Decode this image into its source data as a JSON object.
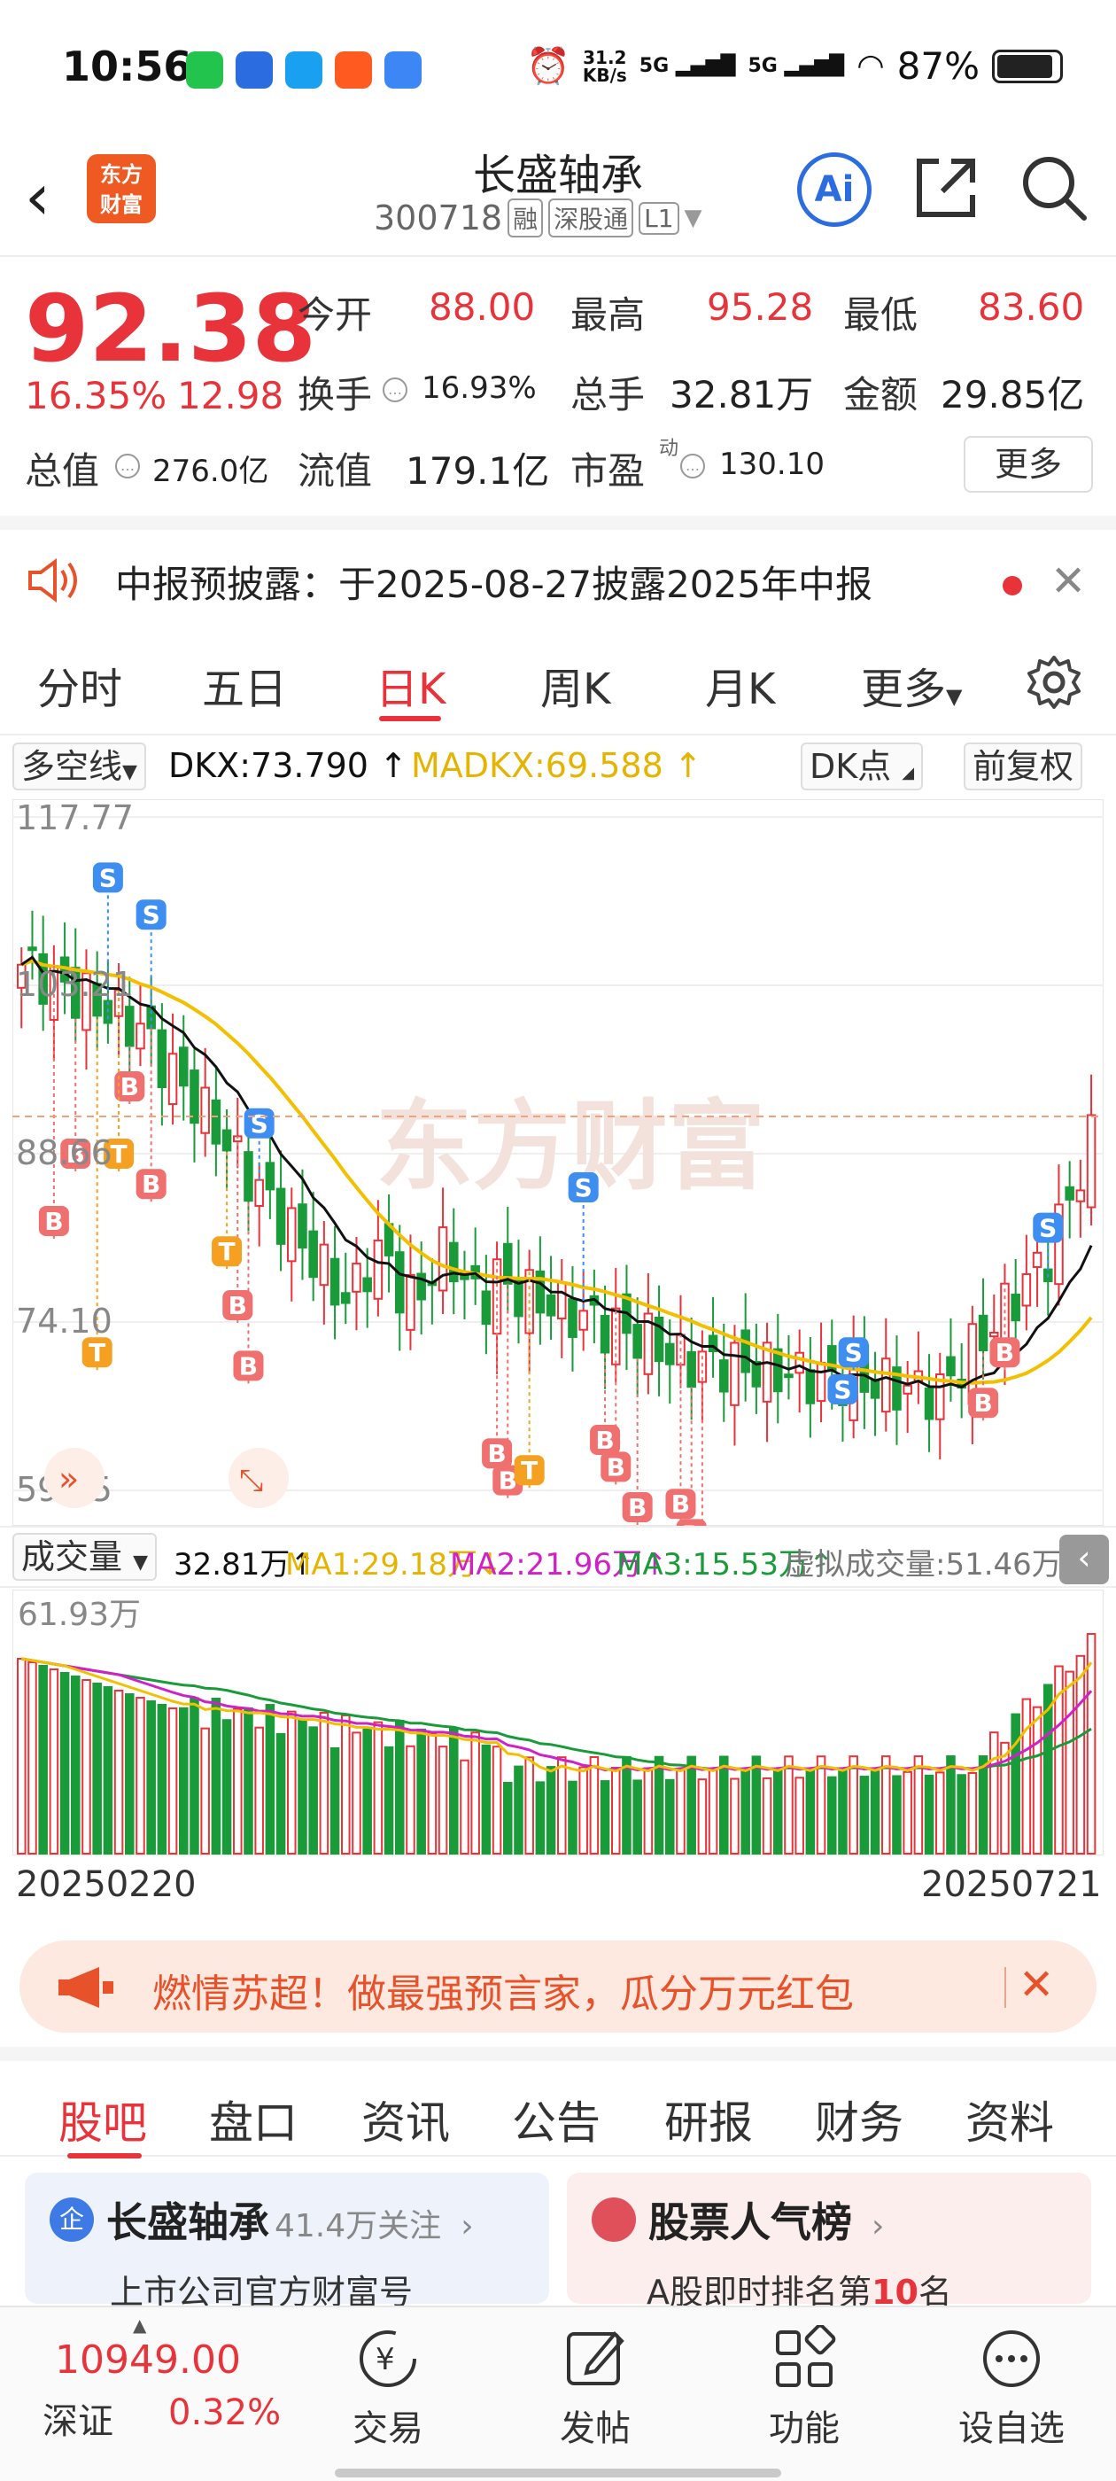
{
  "status_bar": {
    "time": "10:56",
    "net_speed": "31.2",
    "net_unit": "KB/s",
    "sig1": "5G",
    "sig2": "5G",
    "battery": "87%"
  },
  "header": {
    "logo_text_1": "东方",
    "logo_text_2": "财富",
    "stock_name": "长盛轴承",
    "stock_code": "300718",
    "tags": [
      "融",
      "深股通",
      "L1"
    ]
  },
  "quote": {
    "price": "92.38",
    "change_pct": "16.35%",
    "change_amt": "12.98",
    "open_label": "今开",
    "open": "88.00",
    "high_label": "最高",
    "high": "95.28",
    "low_label": "最低",
    "low": "83.60",
    "turnover_label": "换手",
    "turnover": "16.93%",
    "volume_label": "总手",
    "volume": "32.81万",
    "amount_label": "金额",
    "amount": "29.85亿",
    "mktcap_label": "总值",
    "mktcap": "276.0亿",
    "float_label": "流值",
    "float_cap": "179.1亿",
    "pe_label": "市盈",
    "pe_sup": "动",
    "pe": "130.10",
    "more_label": "更多"
  },
  "notice": {
    "text": "中报预披露：于2025-08-27披露2025年中报"
  },
  "period_tabs": [
    {
      "label": "分时"
    },
    {
      "label": "五日"
    },
    {
      "label": "日K"
    },
    {
      "label": "周K"
    },
    {
      "label": "月K"
    },
    {
      "label": "更多"
    }
  ],
  "indicator": {
    "selector": "多空线",
    "dkx": "DKX:73.790",
    "madkx": "MADKX:69.588",
    "dk_point": "DK点",
    "adjust": "前复权"
  },
  "price_axis": [
    "117.77",
    "103.21",
    "88.66",
    "74.10",
    "59.55"
  ],
  "volume_bar": {
    "selector": "成交量",
    "vol": "32.81万",
    "ma1": "MA1:29.18万",
    "ma2": "MA2:21.96万",
    "ma3": "MA3:15.53万",
    "virtual": "虚拟成交量:51.46万",
    "max_label": "61.93万"
  },
  "dates": {
    "start": "20250220",
    "end": "20250721"
  },
  "promo": {
    "text": "燃情苏超！做最强预言家，瓜分万元红包"
  },
  "bottom_tabs": [
    {
      "label": "股吧"
    },
    {
      "label": "盘口"
    },
    {
      "label": "资讯"
    },
    {
      "label": "公告"
    },
    {
      "label": "研报"
    },
    {
      "label": "财务"
    },
    {
      "label": "资料"
    }
  ],
  "cards": {
    "c1_badge": "企",
    "c1_title": "长盛轴承",
    "c1_follow": "41.4万关注",
    "c1_sub": "上市公司官方财富号",
    "c2_title": "股票人气榜",
    "c2_sub_pre": "A股即时排名第",
    "c2_rank": "10",
    "c2_sub_post": "名"
  },
  "nav": {
    "index_value": "10949.00",
    "index_name": "深证",
    "index_pct": "0.32%",
    "items": [
      {
        "label": "交易"
      },
      {
        "label": "发帖"
      },
      {
        "label": "功能"
      },
      {
        "label": "设自选"
      }
    ]
  },
  "colors": {
    "up": "#e8333a",
    "down": "#1a9b3a",
    "dkx": "#111111",
    "madkx": "#f2c000",
    "ma2": "#d020c8"
  }
}
